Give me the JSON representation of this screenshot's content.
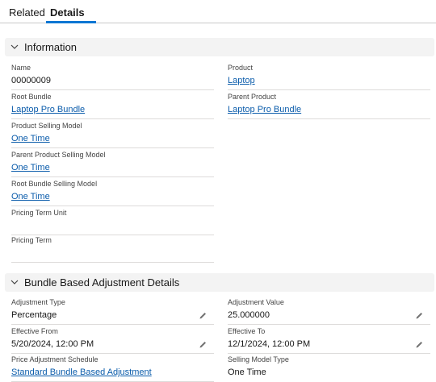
{
  "tabs": {
    "related": "Related",
    "details": "Details"
  },
  "information": {
    "title": "Information",
    "left": [
      {
        "label": "Name",
        "value": "00000009",
        "link": false
      },
      {
        "label": "Root Bundle",
        "value": "Laptop Pro Bundle",
        "link": true
      },
      {
        "label": "Product Selling Model",
        "value": "One Time",
        "link": true
      },
      {
        "label": "Parent Product Selling Model",
        "value": "One Time",
        "link": true
      },
      {
        "label": "Root Bundle Selling Model",
        "value": "One Time",
        "link": true
      },
      {
        "label": "Pricing Term Unit",
        "value": "",
        "link": false
      },
      {
        "label": "Pricing Term",
        "value": "",
        "link": false
      }
    ],
    "right": [
      {
        "label": "Product",
        "value": "Laptop",
        "link": true
      },
      {
        "label": "Parent Product",
        "value": "Laptop Pro Bundle",
        "link": true
      }
    ]
  },
  "adjustment": {
    "title": "Bundle Based Adjustment Details",
    "left": [
      {
        "label": "Adjustment Type",
        "value": "Percentage",
        "link": false,
        "editable": true
      },
      {
        "label": "Effective From",
        "value": "5/20/2024, 12:00 PM",
        "link": false,
        "editable": true
      },
      {
        "label": "Price Adjustment Schedule",
        "value": "Standard Bundle Based Adjustment",
        "link": true,
        "editable": false
      }
    ],
    "right": [
      {
        "label": "Adjustment Value",
        "value": "25.000000",
        "link": false,
        "editable": true
      },
      {
        "label": "Effective To",
        "value": "12/1/2024, 12:00 PM",
        "link": false,
        "editable": true
      },
      {
        "label": "Selling Model Type",
        "value": "One Time",
        "link": false,
        "editable": false
      }
    ]
  },
  "icons": {
    "collapse": "chevron-down-icon",
    "edit": "pencil-icon"
  },
  "colors": {
    "accent": "#0176d3",
    "link": "#0b5cab",
    "section_bg": "#f3f3f3"
  }
}
